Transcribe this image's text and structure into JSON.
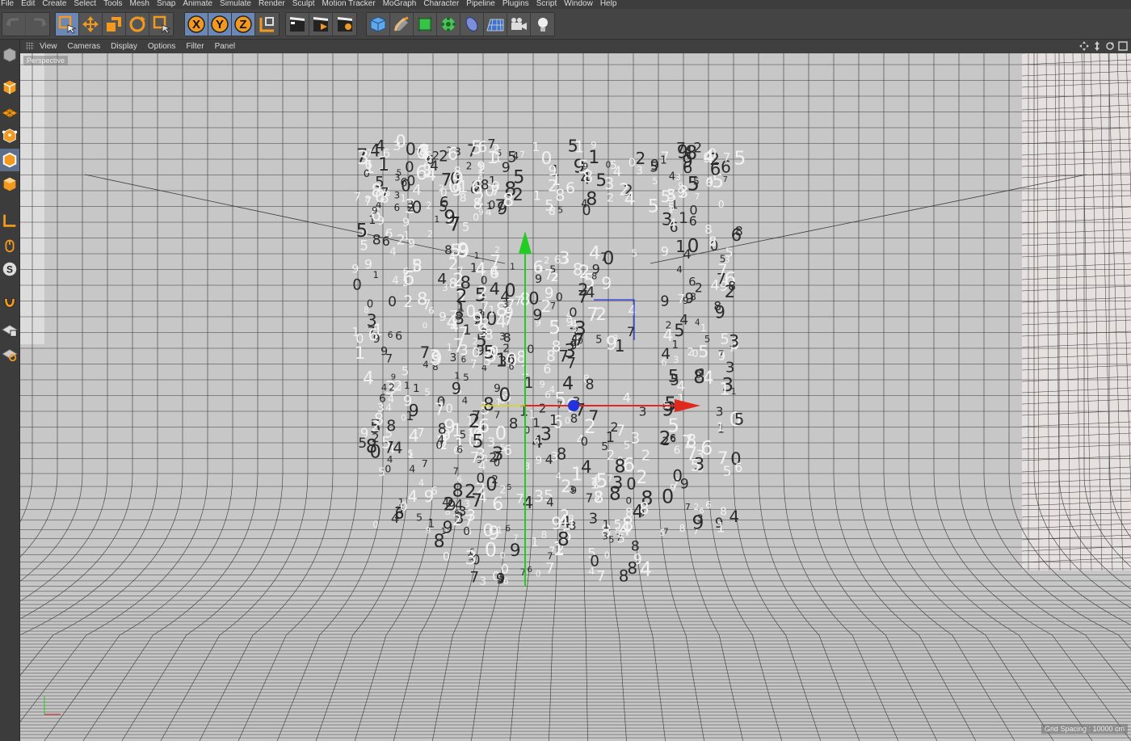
{
  "menu": [
    "File",
    "Edit",
    "Create",
    "Select",
    "Tools",
    "Mesh",
    "Snap",
    "Animate",
    "Simulate",
    "Render",
    "Sculpt",
    "Motion Tracker",
    "MoGraph",
    "Character",
    "Pipeline",
    "Plugins",
    "Script",
    "Window",
    "Help"
  ],
  "toolbar": {
    "groups": [
      {
        "name": "history",
        "buttons": [
          {
            "icon": "undo-icon",
            "dim": true
          },
          {
            "icon": "redo-icon",
            "dim": true
          }
        ]
      },
      {
        "name": "transform",
        "buttons": [
          {
            "icon": "live-selection-icon",
            "active": true
          },
          {
            "icon": "move-icon"
          },
          {
            "icon": "scale-icon"
          },
          {
            "icon": "rotate-icon"
          },
          {
            "icon": "last-tool-icon"
          }
        ]
      },
      {
        "name": "axes",
        "buttons": [
          {
            "icon": "x-axis-lock-icon",
            "label": "X",
            "active": true
          },
          {
            "icon": "y-axis-lock-icon",
            "label": "Y",
            "active": true
          },
          {
            "icon": "z-axis-lock-icon",
            "label": "Z",
            "active": true
          },
          {
            "icon": "coordinate-system-icon"
          }
        ]
      },
      {
        "name": "render",
        "buttons": [
          {
            "icon": "render-view-icon"
          },
          {
            "icon": "render-picture-viewer-icon"
          },
          {
            "icon": "render-settings-icon"
          }
        ]
      },
      {
        "name": "create",
        "buttons": [
          {
            "icon": "cube-icon"
          },
          {
            "icon": "pen-spline-icon"
          },
          {
            "icon": "subdivision-icon"
          },
          {
            "icon": "cloner-icon"
          },
          {
            "icon": "deformer-icon"
          },
          {
            "icon": "floor-icon"
          },
          {
            "icon": "camera-icon"
          },
          {
            "icon": "light-icon"
          }
        ]
      }
    ]
  },
  "left_dock": [
    "model-mode-icon",
    "texture-mode-icon",
    "workplane-icon",
    "points-mode-icon",
    "edges-mode-icon",
    "polygons-mode-icon",
    "axis-mode-icon",
    "tweak-mode-icon",
    "sculpt-mode-icon",
    "snap-icon",
    "lock-workplane-icon",
    "solo-icon"
  ],
  "viewport": {
    "menu": [
      "View",
      "Cameras",
      "Display",
      "Options",
      "Filter",
      "Panel"
    ],
    "view_name": "Perspective",
    "grid_spacing": "Grid Spacing : 10000 cm",
    "colors": {
      "bg": "#c7c7c7",
      "grid": "#3a3a3a",
      "axis_x": "#e0281e",
      "axis_y": "#22cc22",
      "axis_z": "#2233dd"
    }
  }
}
